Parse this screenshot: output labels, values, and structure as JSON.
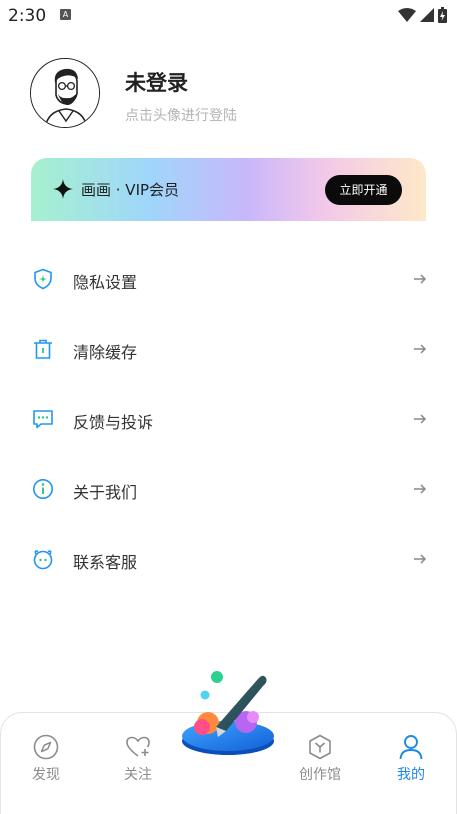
{
  "status_bar": {
    "time": "2:30",
    "notification_badge": "A"
  },
  "profile": {
    "name": "未登录",
    "hint": "点击头像进行登陆"
  },
  "vip": {
    "label": "画画 · VIP会员",
    "button": "立即开通"
  },
  "menu": [
    {
      "label": "隐私设置",
      "icon": "shield-icon"
    },
    {
      "label": "清除缓存",
      "icon": "trash-icon"
    },
    {
      "label": "反馈与投诉",
      "icon": "feedback-icon"
    },
    {
      "label": "关于我们",
      "icon": "info-icon"
    },
    {
      "label": "联系客服",
      "icon": "customer-service-icon"
    }
  ],
  "tabs": [
    {
      "label": "发现",
      "icon": "compass-icon",
      "active": false
    },
    {
      "label": "关注",
      "icon": "heart-plus-icon",
      "active": false
    },
    {
      "label": "创作馆",
      "icon": "cube-icon",
      "active": false
    },
    {
      "label": "我的",
      "icon": "user-icon",
      "active": true
    }
  ],
  "colors": {
    "accent": "#1e88e5",
    "icon_blue": "#2196f3",
    "vip_button_bg": "#0b0b0b",
    "tab_inactive": "#8c8c8c"
  }
}
